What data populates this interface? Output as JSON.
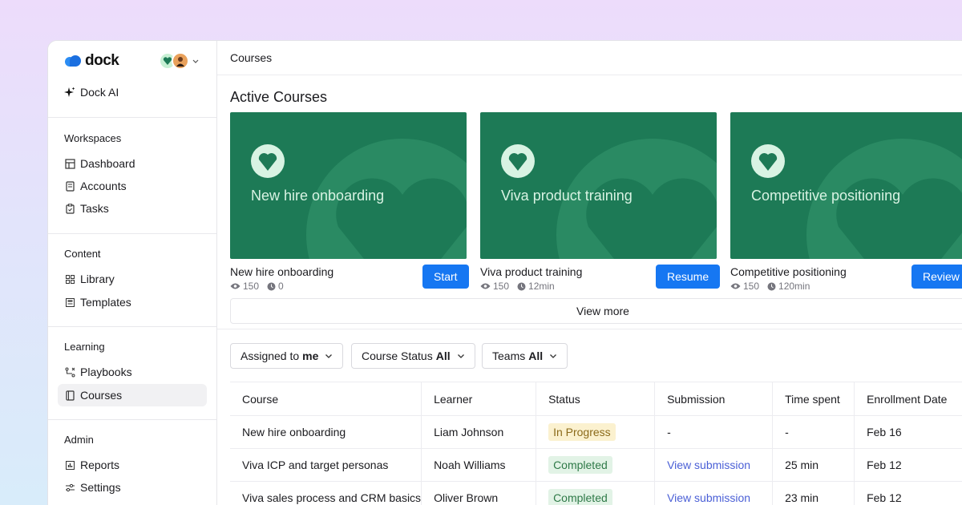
{
  "brand": {
    "name": "dock"
  },
  "sidebar": {
    "dock_ai": "Dock AI",
    "sections": [
      {
        "title": "Workspaces",
        "items": [
          "Dashboard",
          "Accounts",
          "Tasks"
        ]
      },
      {
        "title": "Content",
        "items": [
          "Library",
          "Templates"
        ]
      },
      {
        "title": "Learning",
        "items": [
          "Playbooks",
          "Courses"
        ]
      },
      {
        "title": "Admin",
        "items": [
          "Reports",
          "Settings"
        ]
      }
    ],
    "active_item": "Courses"
  },
  "header": {
    "title": "Courses"
  },
  "active_courses": {
    "title": "Active Courses",
    "cards": [
      {
        "thumb_title": "New hire onboarding",
        "name": "New hire onboarding",
        "views": "150",
        "time": "0",
        "button": "Start"
      },
      {
        "thumb_title": "Viva product training",
        "name": "Viva product training",
        "views": "150",
        "time": "12min",
        "button": "Resume"
      },
      {
        "thumb_title": "Competitive positioning",
        "name": "Competitive positioning",
        "views": "150",
        "time": "120min",
        "button": "Review"
      }
    ],
    "view_more": "View more"
  },
  "filters": [
    {
      "label": "Assigned to",
      "value": "me"
    },
    {
      "label": "Course Status",
      "value": "All"
    },
    {
      "label": "Teams",
      "value": "All"
    }
  ],
  "table": {
    "columns": [
      "Course",
      "Learner",
      "Status",
      "Submission",
      "Time spent",
      "Enrollment Date"
    ],
    "rows": [
      {
        "course": "New hire onboarding",
        "learner": "Liam Johnson",
        "status": "In Progress",
        "submission": "-",
        "time_spent": "-",
        "enrollment_date": "Feb 16"
      },
      {
        "course": "Viva ICP and target personas",
        "learner": "Noah Williams",
        "status": "Completed",
        "submission": "View submission",
        "time_spent": "25 min",
        "enrollment_date": "Feb 12"
      },
      {
        "course": "Viva sales process and CRM basics",
        "learner": "Oliver Brown",
        "status": "Completed",
        "submission": "View submission",
        "time_spent": "23 min",
        "enrollment_date": "Feb 12"
      }
    ]
  },
  "colors": {
    "card_green": "#1d7a56",
    "primary_button": "#1677f2",
    "link": "#4a5fd6",
    "in_progress_bg": "#fbf1cf",
    "completed_bg": "#e2f3e6"
  }
}
